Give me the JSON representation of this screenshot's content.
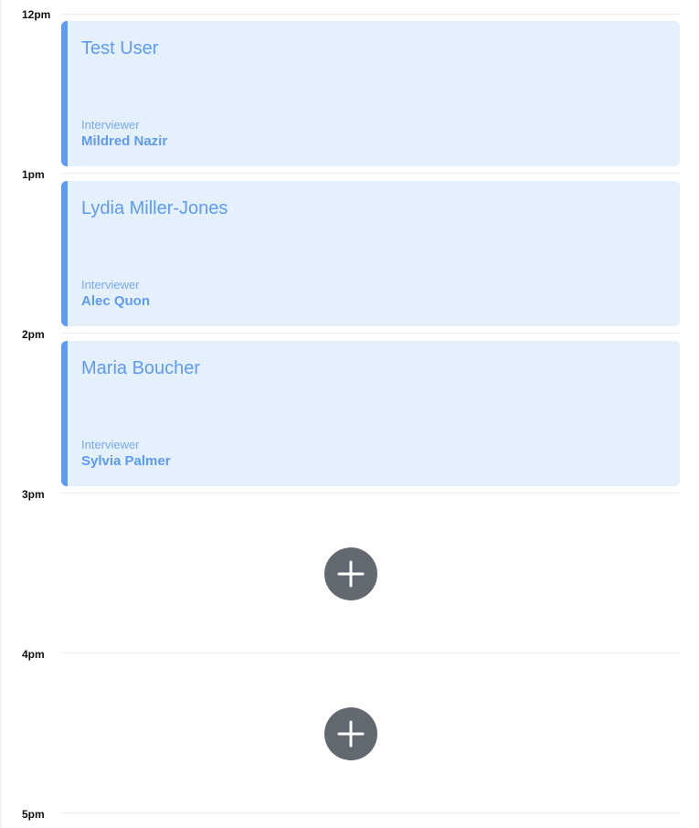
{
  "colors": {
    "event_background": "#e5f0fd",
    "event_accent": "#5e9bf2",
    "add_button": "#636970",
    "hour_line": "#eceef1"
  },
  "time_labels": [
    "12pm",
    "1pm",
    "2pm",
    "3pm",
    "4pm",
    "5pm"
  ],
  "events": [
    {
      "candidate": "Test User",
      "role_label": "Interviewer",
      "interviewer": "Mildred Nazir"
    },
    {
      "candidate": "Lydia Miller-Jones",
      "role_label": "Interviewer",
      "interviewer": "Alec Quon"
    },
    {
      "candidate": "Maria Boucher",
      "role_label": "Interviewer",
      "interviewer": "Sylvia Palmer"
    }
  ],
  "empty_slots": [
    {
      "icon": "plus-icon"
    },
    {
      "icon": "plus-icon"
    }
  ]
}
